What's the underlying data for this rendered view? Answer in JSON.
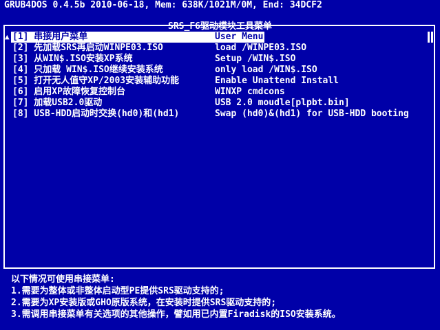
{
  "status_bar": {
    "text": "GRUB4DOS 0.4.5b 2010-06-18, Mem: 638K/1021M/0M, End: 34DCF2"
  },
  "menu": {
    "title": "SRS_F6驱动模块工具菜单",
    "scroll_up_indicator": "▲",
    "items": [
      {
        "label": "[1] 串接用户菜单",
        "description": "User Menu"
      },
      {
        "label": "[2] 先加载SRS再启动WINPE03.ISO",
        "description": "load /WINPE03.ISO"
      },
      {
        "label": "[3] 从WIN$.ISO安装XP系统",
        "description": "Setup /WIN$.ISO"
      },
      {
        "label": "[4] 只加载 WIN$.ISO继续安装系统",
        "description": "only load /WIN$.ISO"
      },
      {
        "label": "[5] 打开无人值守XP/2003安装辅助功能",
        "description": "Enable Unattend Install"
      },
      {
        "label": "[6] 启用XP故障恢复控制台",
        "description": "WINXP cmdcons"
      },
      {
        "label": "[7] 加载USB2.0驱动",
        "description": "USB 2.0 moudle[plpbt.bin]"
      },
      {
        "label": "[8] USB-HDD启动时交换(hd0)和(hd1)",
        "description": "Swap (hd0)&(hd1) for USB-HDD booting"
      }
    ]
  },
  "notes": [
    "以下情况可使用串接菜单:",
    "1.需要为整体或非整体启动型PE提供SRS驱动支持的;",
    "2.需要为XP安装版或GHO原版系统，在安装时提供SRS驱动支持的;",
    "3.需调用串接菜单有关选项的其他操作，譬如用已内置Firadisk的ISO安装系统。"
  ]
}
